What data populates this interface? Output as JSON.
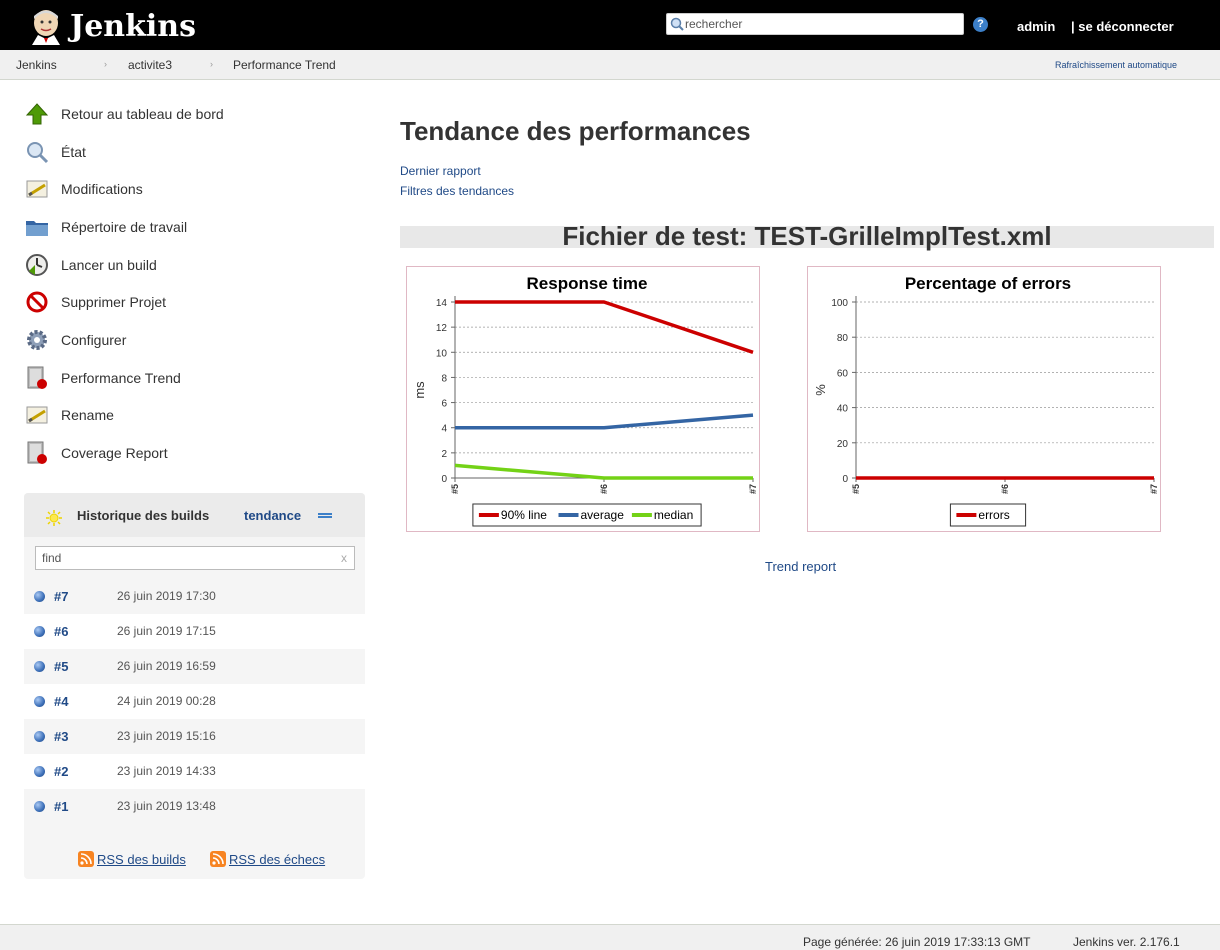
{
  "header": {
    "logo_text": "Jenkins",
    "search_placeholder": "rechercher",
    "help_label": "?",
    "user": "admin",
    "logout": "| se déconnecter"
  },
  "breadcrumbs": [
    "Jenkins",
    "activite3",
    "Performance Trend"
  ],
  "auto_refresh": "Rafraîchissement automatique",
  "tasks": [
    {
      "label": "Retour au tableau de bord",
      "icon": "up-arrow-icon"
    },
    {
      "label": "État",
      "icon": "magnifier-icon"
    },
    {
      "label": "Modifications",
      "icon": "notepad-icon"
    },
    {
      "label": "Répertoire de travail",
      "icon": "folder-icon"
    },
    {
      "label": "Lancer un build",
      "icon": "clock-icon"
    },
    {
      "label": "Supprimer Projet",
      "icon": "no-entry-icon"
    },
    {
      "label": "Configurer",
      "icon": "gear-icon"
    },
    {
      "label": "Performance Trend",
      "icon": "report-icon"
    },
    {
      "label": "Rename",
      "icon": "notepad-icon"
    },
    {
      "label": "Coverage Report",
      "icon": "report-icon"
    }
  ],
  "history": {
    "title": "Historique des builds",
    "trend": "tendance",
    "find_value": "find",
    "clear": "x",
    "builds": [
      {
        "num": "#7",
        "date": "26 juin 2019 17:30"
      },
      {
        "num": "#6",
        "date": "26 juin 2019 17:15"
      },
      {
        "num": "#5",
        "date": "26 juin 2019 16:59"
      },
      {
        "num": "#4",
        "date": "24 juin 2019 00:28"
      },
      {
        "num": "#3",
        "date": "23 juin 2019 15:16"
      },
      {
        "num": "#2",
        "date": "23 juin 2019 14:33"
      },
      {
        "num": "#1",
        "date": "23 juin 2019 13:48"
      }
    ],
    "rss_builds": "RSS des builds",
    "rss_failures": "RSS des échecs"
  },
  "main": {
    "title": "Tendance des performances",
    "last_report": "Dernier rapport",
    "filters": "Filtres des tendances",
    "file_heading": "Fichier de test: TEST-GrilleImplTest.xml",
    "trend_report": "Trend report"
  },
  "colors": {
    "header_bg": "#000000",
    "line_90": "#cc0000",
    "line_avg": "#3465a4",
    "line_median": "#73d216",
    "link": "#204a87"
  },
  "chart_data": [
    {
      "type": "line",
      "title": "Response time",
      "ylabel": "ms",
      "x": [
        "#5",
        "#6",
        "#7"
      ],
      "ylim": [
        0,
        14
      ],
      "yticks": [
        0,
        2,
        4,
        6,
        8,
        10,
        12,
        14
      ],
      "grid": true,
      "legend_position": "bottom",
      "series": [
        {
          "name": "90% line",
          "color": "#cc0000",
          "values": [
            14,
            14,
            10
          ]
        },
        {
          "name": "average",
          "color": "#3465a4",
          "values": [
            4,
            4,
            5
          ]
        },
        {
          "name": "median",
          "color": "#73d216",
          "values": [
            1,
            0,
            0
          ]
        }
      ]
    },
    {
      "type": "line",
      "title": "Percentage of errors",
      "ylabel": "%",
      "x": [
        "#5",
        "#6",
        "#7"
      ],
      "ylim": [
        0,
        100
      ],
      "yticks": [
        0,
        20,
        40,
        60,
        80,
        100
      ],
      "grid": true,
      "legend_position": "bottom",
      "series": [
        {
          "name": "errors",
          "color": "#cc0000",
          "values": [
            0,
            0,
            0
          ]
        }
      ]
    }
  ],
  "footer": {
    "generated": "Page générée: 26 juin 2019 17:33:13 GMT",
    "version": "Jenkins ver. 2.176.1"
  }
}
